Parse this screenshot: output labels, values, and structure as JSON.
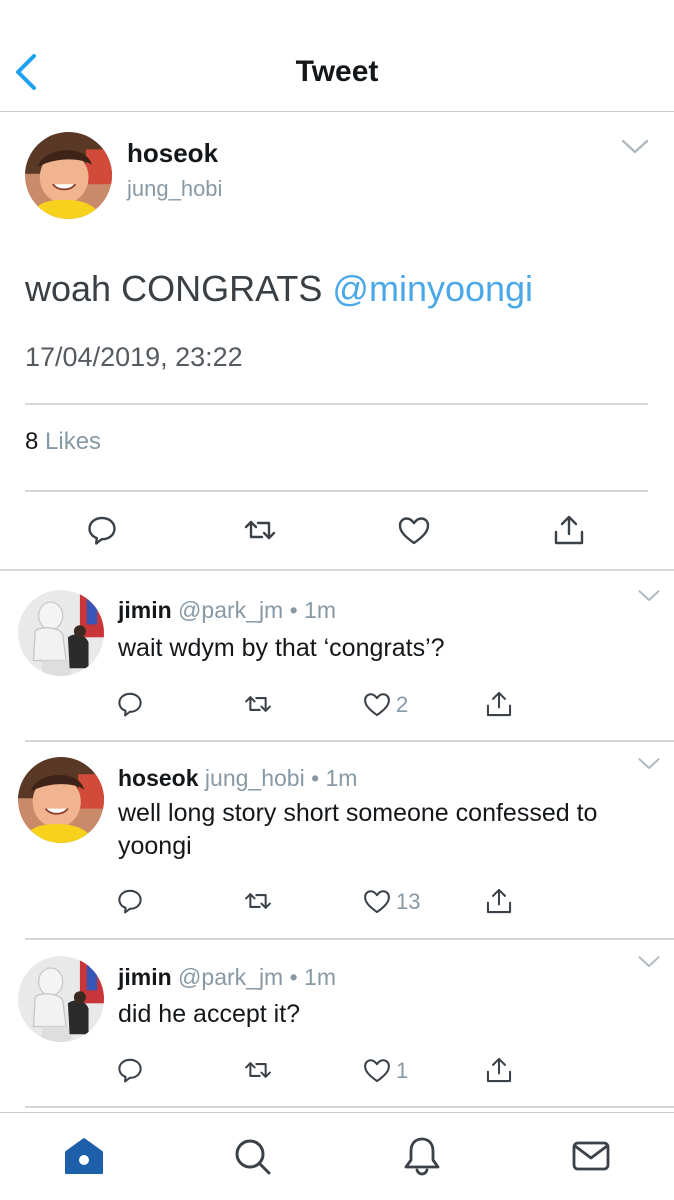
{
  "header": {
    "title": "Tweet"
  },
  "tweet": {
    "name": "hoseok",
    "handle": "jung_hobi",
    "text": "woah CONGRATS ",
    "mention": "@minyoongi",
    "timestamp": "17/04/2019, 23:22",
    "likes_count": "8",
    "likes_label": " Likes"
  },
  "replies": [
    {
      "name": "jimin",
      "meta": " @park_jm • 1m",
      "text": "wait wdym by that ‘congrats’?",
      "like_count": "2"
    },
    {
      "name": "hoseok",
      "meta": " jung_hobi • 1m",
      "text": "well long story short someone confessed to yoongi",
      "like_count": "13"
    },
    {
      "name": "jimin",
      "meta": " @park_jm • 1m",
      "text": "did he accept it?",
      "like_count": "1"
    }
  ],
  "colors": {
    "accent": "#1da1f2",
    "mention": "#4aa8e8",
    "muted": "#8899a6",
    "tab_active": "#1d5fa8"
  },
  "icons": [
    "back-chevron-icon",
    "chevron-down-icon",
    "reply-icon",
    "retweet-icon",
    "like-icon",
    "share-icon",
    "home-icon",
    "search-icon",
    "notifications-icon",
    "messages-icon"
  ]
}
